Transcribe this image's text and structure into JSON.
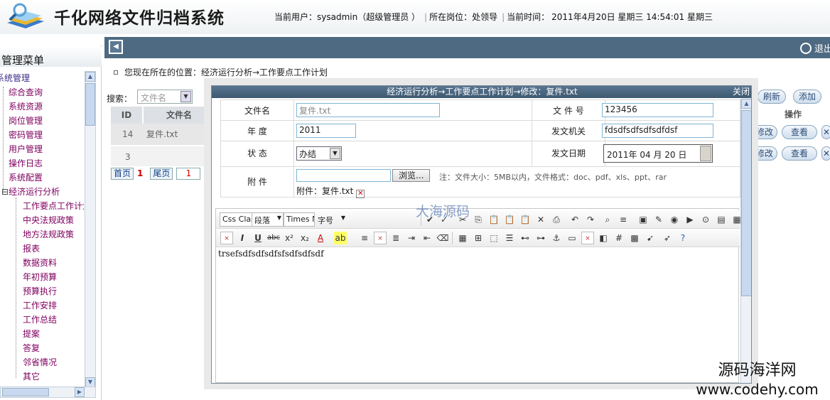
{
  "app": {
    "title": "千化网络文件归档系统"
  },
  "status": {
    "user_label": "当前用户：sysadmin（超级管理员 ）",
    "post_label": "所在岗位：处领导",
    "time_label": "当前时间：",
    "time_value": "2011年4月20日 星期三 14:54:01 星期三"
  },
  "topnav": {
    "logout": "退出"
  },
  "sidebar": {
    "title": "管理菜单",
    "items": [
      "系统管理",
      "综合查询",
      "系统资源",
      "岗位管理",
      "密码管理",
      "用户管理",
      "操作日志",
      "系统配置",
      "经济运行分析"
    ],
    "subitems": [
      "工作要点工作计划",
      "中央法规政策",
      "地方法规政策",
      "报表",
      "数据资料",
      "年初预算",
      "预算执行",
      "工作安排",
      "工作总结",
      "提案",
      "答复",
      "邻省情况",
      "其它"
    ]
  },
  "breadcrumb": {
    "text": "您现在所在的位置：经济运行分析→工作要点工作计划"
  },
  "search": {
    "label": "搜索：",
    "field_value": "文件名"
  },
  "list": {
    "headers": [
      "ID",
      "文件名"
    ],
    "rows": [
      {
        "id": "14",
        "name": "复件.txt"
      },
      {
        "id": "3",
        "name": ""
      }
    ],
    "actions_header": "操作",
    "refresh": "刷新",
    "add": "添加",
    "edit": "修改",
    "view": "查看"
  },
  "pager": {
    "first": "首页",
    "current": "1",
    "last": "尾页",
    "page_input": "1"
  },
  "dialog": {
    "title": "经济运行分析→工作要点工作计划→修改：复件.txt",
    "close": "关闭",
    "fields": {
      "filename_label": "文件名",
      "filename_value": "复件.txt",
      "docnum_label": "文 件 号",
      "docnum_value": "123456",
      "year_label": "年 度",
      "year_value": "2011",
      "issuer_label": "发文机关",
      "issuer_value": "fdsdfsdfsdfsdfdsf",
      "state_label": "状 态",
      "state_value": "办结",
      "date_label": "发文日期",
      "date_value": "2011年  04 月  20 日",
      "attach_label": "附 件",
      "browse": "浏览...",
      "note": "注：文件大小：5MB以内，文件格式：doc、pdf、xls、ppt、rar",
      "attach_current": "附件：复件.txt"
    },
    "editor": {
      "css_class": "Css Clas",
      "format": "段落",
      "font": "Times Ne",
      "size": "字号",
      "content": "trsefsdfsdfsdfsfsdfsdfsdf"
    }
  },
  "watermark": "大海源码",
  "site": {
    "name": "源码海洋网",
    "url": "www.codehy.com"
  }
}
